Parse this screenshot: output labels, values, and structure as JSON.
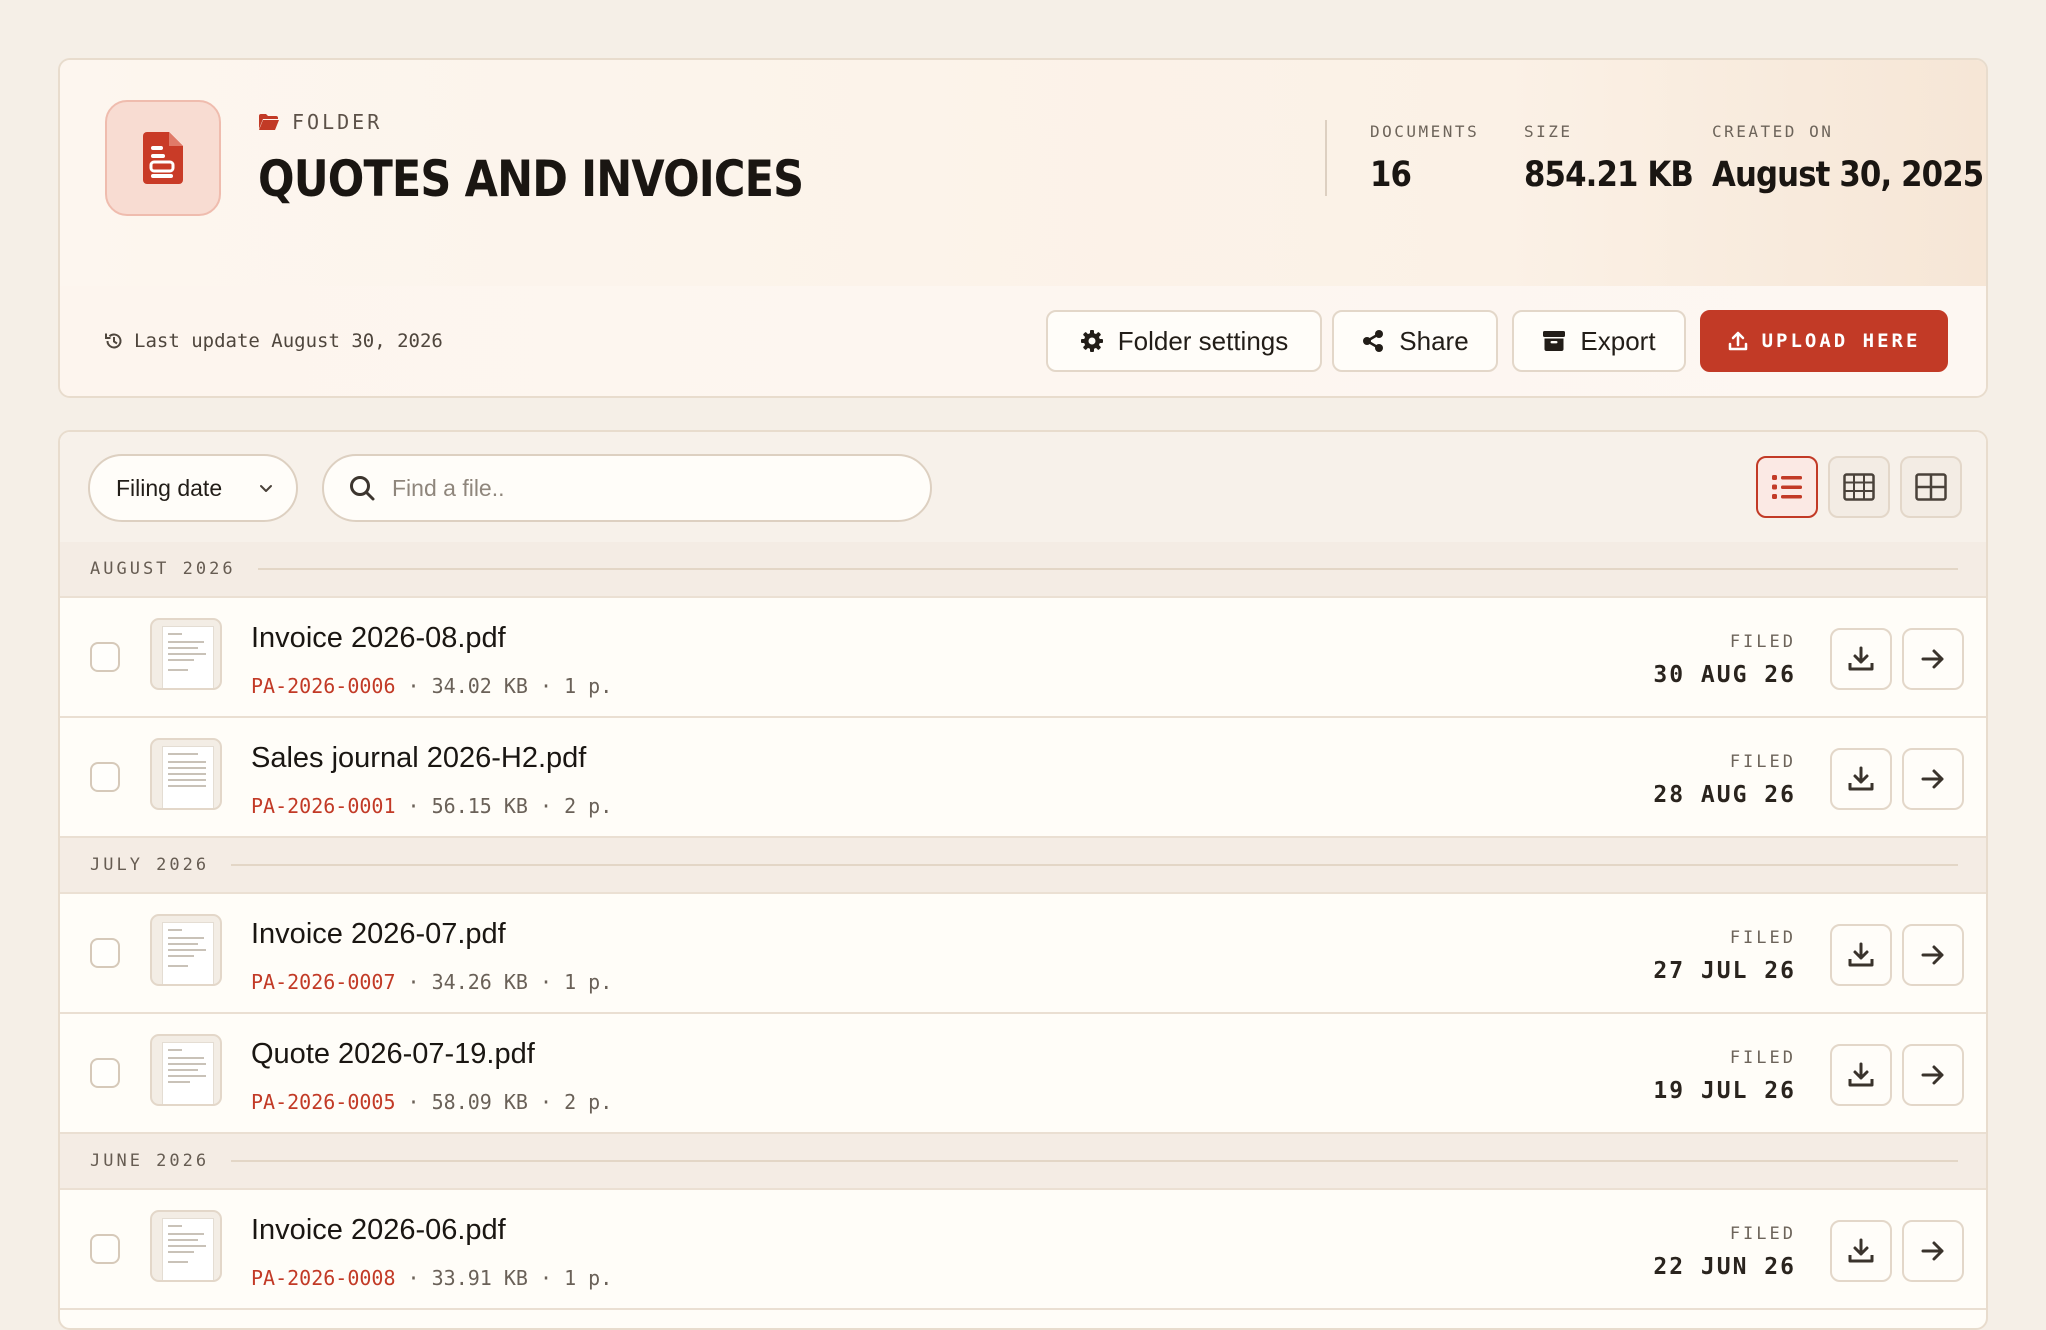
{
  "header": {
    "eyebrow": "FOLDER",
    "title": "QUOTES AND INVOICES",
    "stats": [
      {
        "label": "DOCUMENTS",
        "value": "16"
      },
      {
        "label": "SIZE",
        "value": "854.21 KB"
      },
      {
        "label": "CREATED ON",
        "value": "August 30, 2025"
      }
    ],
    "last_update": "Last update August 30, 2026",
    "actions": {
      "settings": "Folder settings",
      "share": "Share",
      "export": "Export",
      "upload": "UPLOAD HERE"
    }
  },
  "toolbar": {
    "sort_value": "Filing date",
    "search_placeholder": "Find a file.."
  },
  "filed_label": "FILED",
  "groups": [
    {
      "label": "AUGUST 2026",
      "files": [
        {
          "name": "Invoice 2026-08.pdf",
          "ref": "PA-2026-0006",
          "meta": " · 34.02 KB · 1 p.",
          "date": "30 AUG 26"
        },
        {
          "name": "Sales journal 2026-H2.pdf",
          "ref": "PA-2026-0001",
          "meta": " · 56.15 KB · 2 p.",
          "date": "28 AUG 26"
        }
      ]
    },
    {
      "label": "JULY 2026",
      "files": [
        {
          "name": "Invoice 2026-07.pdf",
          "ref": "PA-2026-0007",
          "meta": " · 34.26 KB · 1 p.",
          "date": "27 JUL 26"
        },
        {
          "name": "Quote 2026-07-19.pdf",
          "ref": "PA-2026-0005",
          "meta": " · 58.09 KB · 2 p.",
          "date": "19 JUL 26"
        }
      ]
    },
    {
      "label": "JUNE 2026",
      "files": [
        {
          "name": "Invoice 2026-06.pdf",
          "ref": "PA-2026-0008",
          "meta": " · 33.91 KB · 1 p.",
          "date": "22 JUN 26"
        }
      ]
    }
  ],
  "colors": {
    "accent": "#c23a26",
    "background": "#f5efe7",
    "card": "#fffdf8"
  }
}
